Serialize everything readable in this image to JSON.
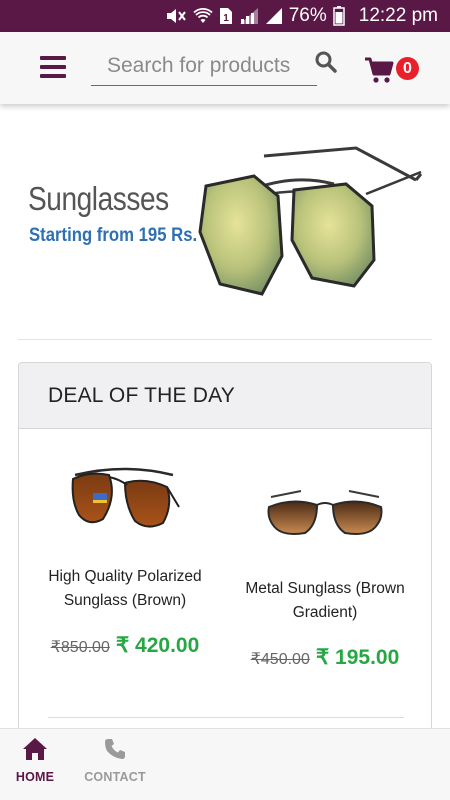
{
  "status_bar": {
    "battery": "76%",
    "time": "12:22 pm",
    "icons": [
      "mute-icon",
      "wifi-icon",
      "sim-icon",
      "signal-icon",
      "signal-icon",
      "battery-icon"
    ]
  },
  "header": {
    "menu_icon": "hamburger-menu-icon",
    "search_placeholder": "Search for products",
    "search_icon": "search-icon",
    "cart_icon": "shopping-cart-icon",
    "cart_count": "0"
  },
  "banner": {
    "title": "Sunglasses",
    "subtitle": "Starting from 195 Rs."
  },
  "deal": {
    "title": "DEAL OF THE DAY",
    "products": [
      {
        "name": "High Quality Polarized Sunglass (Brown)",
        "old_price": "₹850.00",
        "new_price": "₹ 420.00"
      },
      {
        "name": "Metal Sunglass (Brown Gradient)",
        "old_price": "₹450.00",
        "new_price": "₹ 195.00"
      }
    ]
  },
  "bottom_nav": {
    "items": [
      {
        "label": "HOME",
        "icon": "home-icon",
        "active": true
      },
      {
        "label": "CONTACT",
        "icon": "phone-icon",
        "active": false
      }
    ]
  },
  "colors": {
    "brand": "#5a1846",
    "badge": "#e8202b",
    "price_green": "#27a744",
    "banner_blue": "#2f6fb3"
  }
}
